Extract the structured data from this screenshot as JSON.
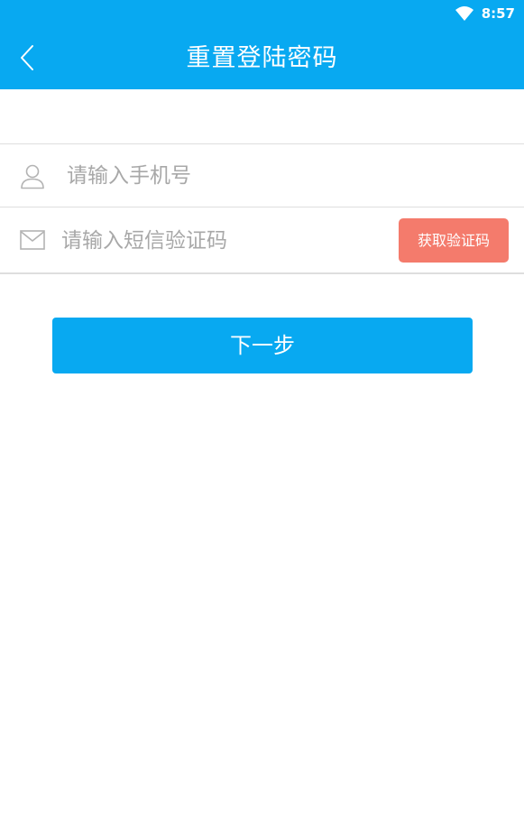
{
  "status_bar": {
    "time": "8:57",
    "icons": [
      "wifi-icon"
    ]
  },
  "header": {
    "back_icon": "chevron-left-icon",
    "title": "重置登陆密码"
  },
  "form": {
    "phone": {
      "icon": "user-icon",
      "value": "",
      "placeholder": "请输入手机号"
    },
    "code": {
      "icon": "mail-icon",
      "value": "",
      "placeholder": "请输入短信验证码",
      "get_code_label": "获取验证码"
    }
  },
  "next_button": {
    "label": "下一步"
  },
  "colors": {
    "primary": "#08a9f1",
    "code_button": "#f47b6c",
    "placeholder": "#a8a8a8",
    "divider": "#dedede"
  }
}
